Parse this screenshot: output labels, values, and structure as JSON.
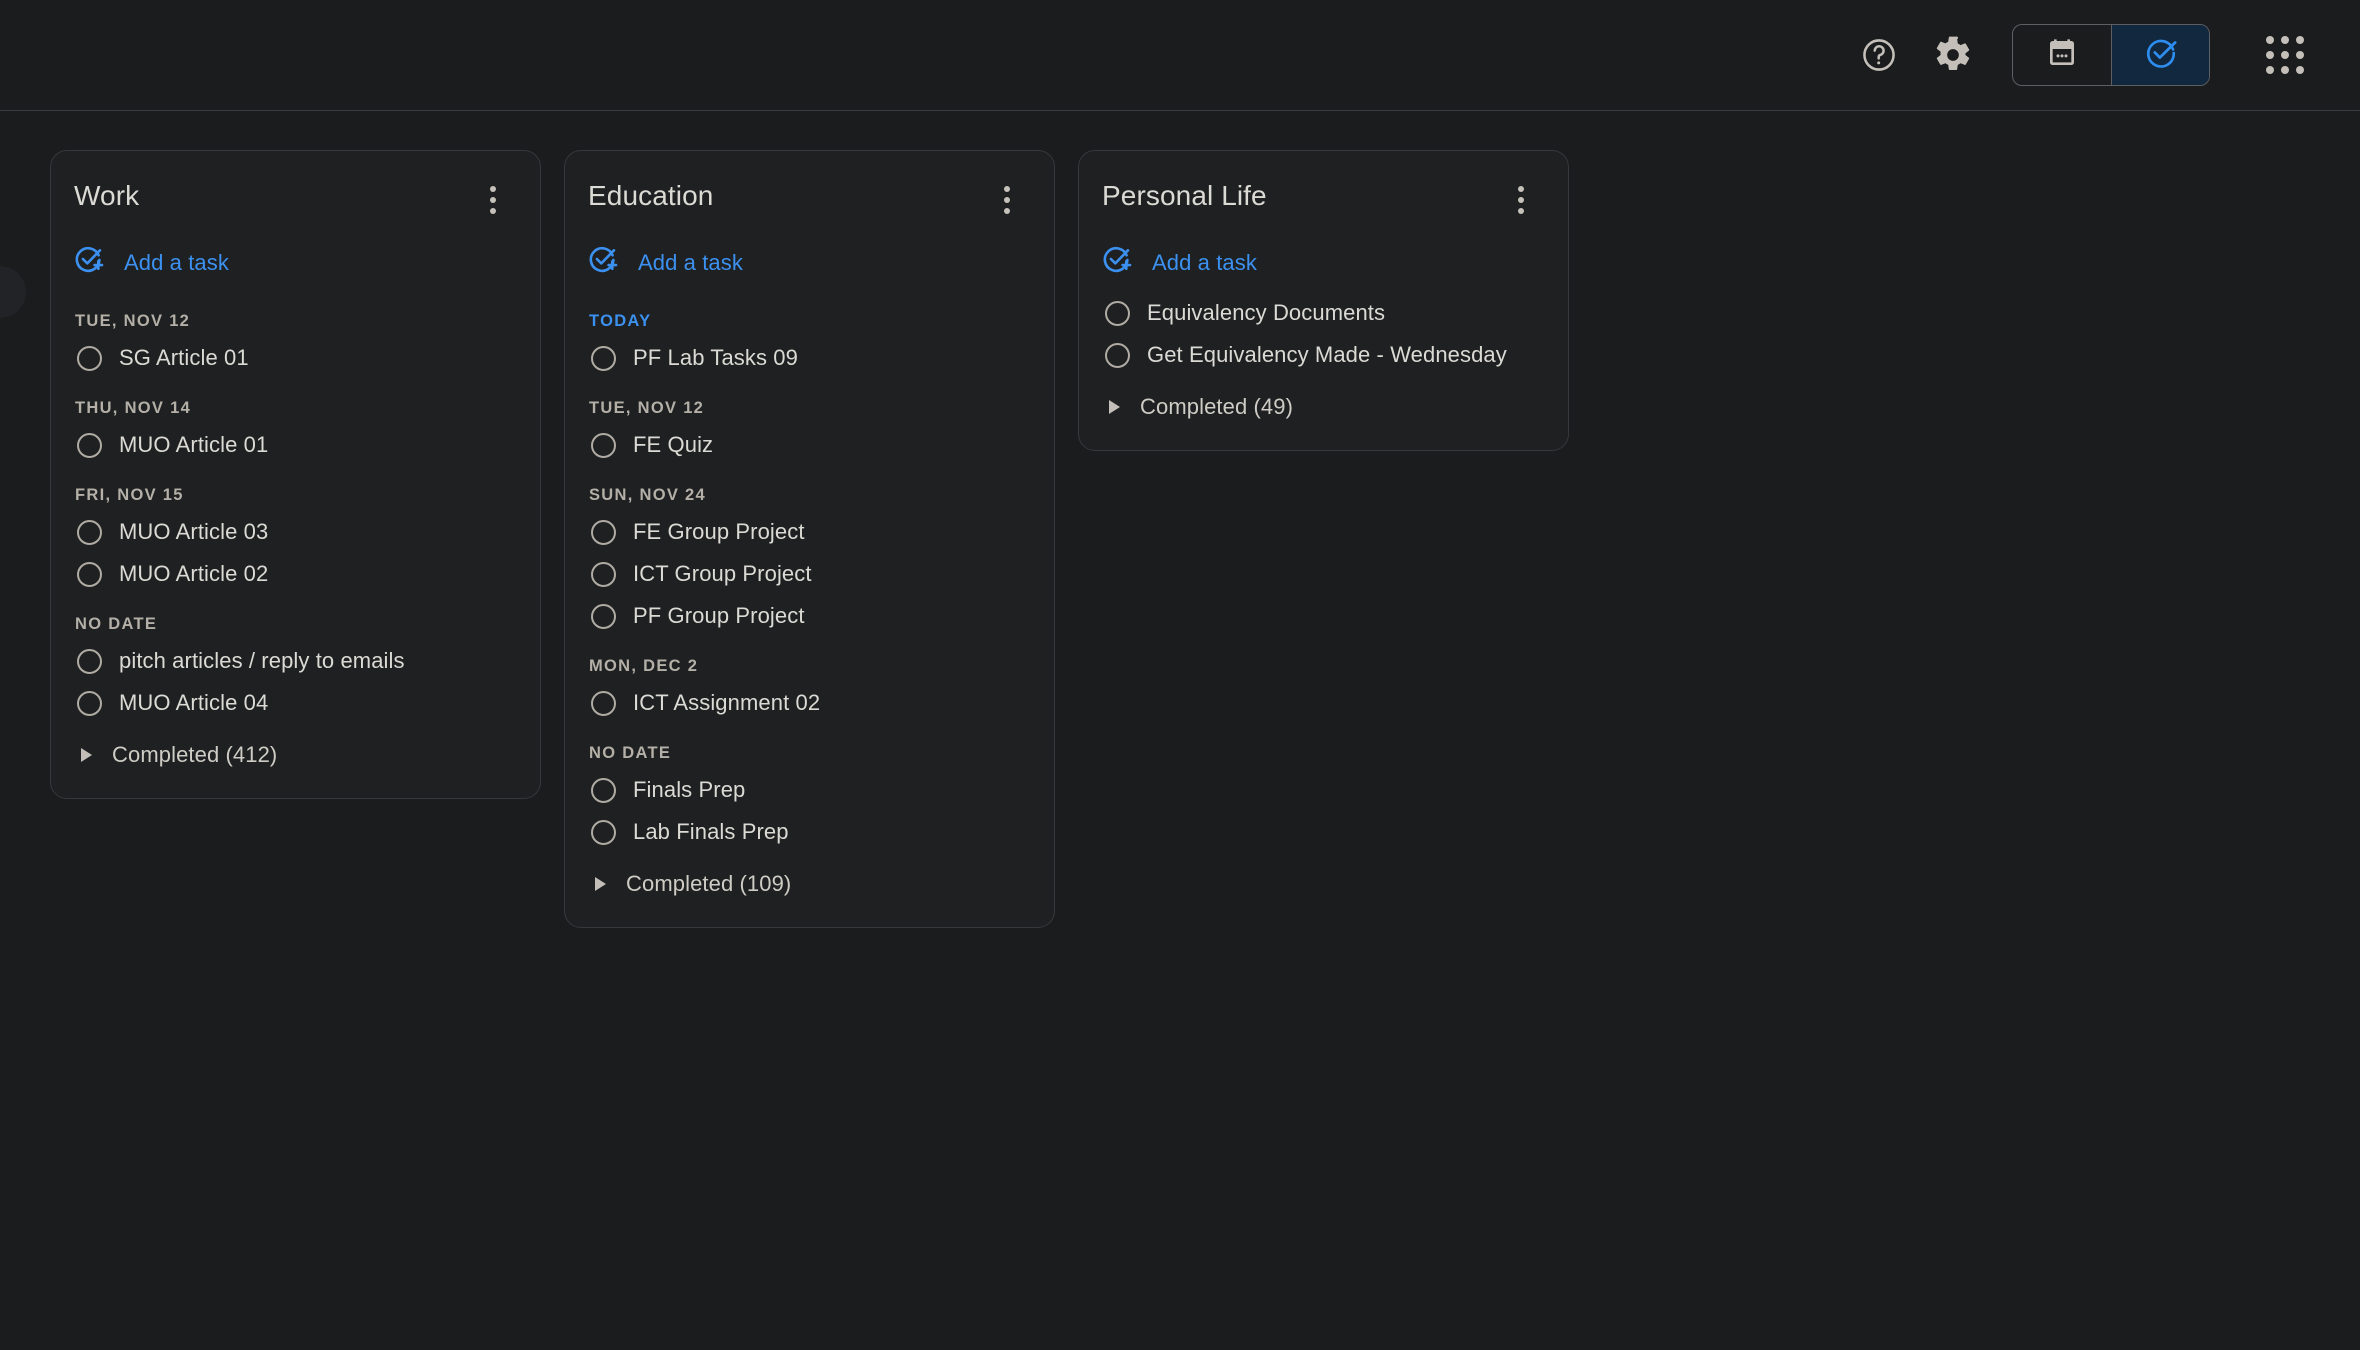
{
  "topbar": {
    "help_icon": "help-circle-icon",
    "settings_icon": "gear-icon",
    "calendar_toggle_icon": "calendar-icon",
    "tasks_toggle_icon": "tasks-check-circle-icon",
    "apps_icon": "apps-grid-icon",
    "accent_color": "#3c91f0",
    "active_toggle": "tasks"
  },
  "board": {
    "lists": [
      {
        "title": "Work",
        "add_task_label": "Add a task",
        "menu_icon": "more-vertical-icon",
        "groups": [
          {
            "date": "TUE, NOV 12",
            "is_today": false,
            "tasks": [
              "SG Article 01"
            ]
          },
          {
            "date": "THU, NOV 14",
            "is_today": false,
            "tasks": [
              "MUO Article 01"
            ]
          },
          {
            "date": "FRI, NOV 15",
            "is_today": false,
            "tasks": [
              "MUO Article 03",
              "MUO Article 02"
            ]
          },
          {
            "date": "NO DATE",
            "is_today": false,
            "tasks": [
              "pitch articles / reply to emails",
              "MUO Article 04"
            ]
          }
        ],
        "completed_label": "Completed (412)",
        "completed_count": 412
      },
      {
        "title": "Education",
        "add_task_label": "Add a task",
        "menu_icon": "more-vertical-icon",
        "groups": [
          {
            "date": "TODAY",
            "is_today": true,
            "tasks": [
              "PF Lab Tasks 09"
            ]
          },
          {
            "date": "TUE, NOV 12",
            "is_today": false,
            "tasks": [
              "FE Quiz"
            ]
          },
          {
            "date": "SUN, NOV 24",
            "is_today": false,
            "tasks": [
              "FE Group Project",
              "ICT Group Project",
              "PF Group Project"
            ]
          },
          {
            "date": "MON, DEC 2",
            "is_today": false,
            "tasks": [
              "ICT Assignment 02"
            ]
          },
          {
            "date": "NO DATE",
            "is_today": false,
            "tasks": [
              "Finals Prep",
              "Lab Finals Prep"
            ]
          }
        ],
        "completed_label": "Completed (109)",
        "completed_count": 109
      },
      {
        "title": "Personal Life",
        "add_task_label": "Add a task",
        "menu_icon": "more-vertical-icon",
        "groups": [
          {
            "date": "",
            "is_today": false,
            "tasks": [
              "Equivalency Documents",
              "Get Equivalency Made - Wednesday"
            ]
          }
        ],
        "completed_label": "Completed (49)",
        "completed_count": 49
      }
    ]
  }
}
